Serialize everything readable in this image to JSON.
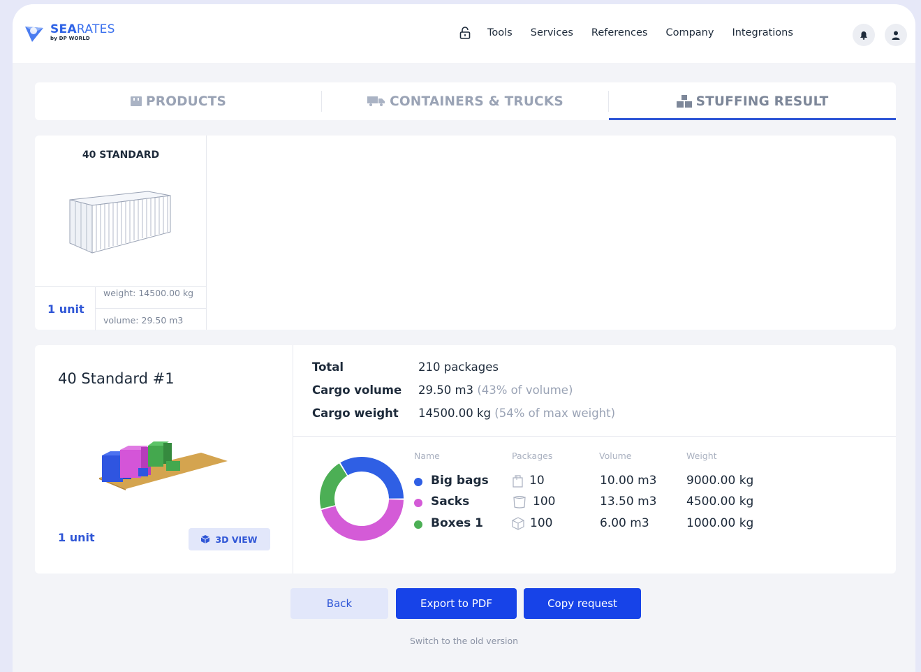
{
  "brand": {
    "name_bold": "SEA",
    "name_regular": "RATES",
    "sub": "by DP WORLD"
  },
  "nav": {
    "items": [
      "Tools",
      "Services",
      "References",
      "Company",
      "Integrations"
    ]
  },
  "tabs": [
    {
      "label": "PRODUCTS",
      "active": false
    },
    {
      "label": "CONTAINERS & TRUCKS",
      "active": false
    },
    {
      "label": "STUFFING RESULT",
      "active": true
    }
  ],
  "container_card": {
    "title": "40 STANDARD",
    "units": "1 unit",
    "weight": "weight: 14500.00 kg",
    "volume": "volume: 29.50 m3"
  },
  "result": {
    "title": "40 Standard #1",
    "units": "1 unit",
    "view_3d_label": "3D VIEW",
    "summary": {
      "total_label": "Total",
      "total_value": "210 packages",
      "volume_label": "Cargo volume",
      "volume_value": "29.50 m3",
      "volume_pct": "(43% of volume)",
      "weight_label": "Cargo weight",
      "weight_value": "14500.00 kg",
      "weight_pct": "(54% of max weight)"
    },
    "columns": [
      "Name",
      "Packages",
      "Volume",
      "Weight"
    ],
    "items": [
      {
        "name": "Big bags",
        "packages": "10",
        "volume": "10.00 m3",
        "weight": "9000.00 kg",
        "color": "#2f5fe4",
        "icon": "bag-icon"
      },
      {
        "name": "Sacks",
        "packages": "100",
        "volume": "13.50 m3",
        "weight": "4500.00 kg",
        "color": "#d45bd7",
        "icon": "sack-icon"
      },
      {
        "name": "Boxes 1",
        "packages": "100",
        "volume": "6.00 m3",
        "weight": "1000.00 kg",
        "color": "#4caf55",
        "icon": "box-icon"
      }
    ],
    "donut_shares": [
      0.339,
      0.458,
      0.203
    ]
  },
  "buttons": {
    "back": "Back",
    "export": "Export to PDF",
    "copy": "Copy request"
  },
  "footer_link": "Switch to the old version",
  "colors": {
    "accent": "#2f56d6",
    "primary_button": "#1743e8",
    "secondary_button": "#e2e7fa"
  }
}
